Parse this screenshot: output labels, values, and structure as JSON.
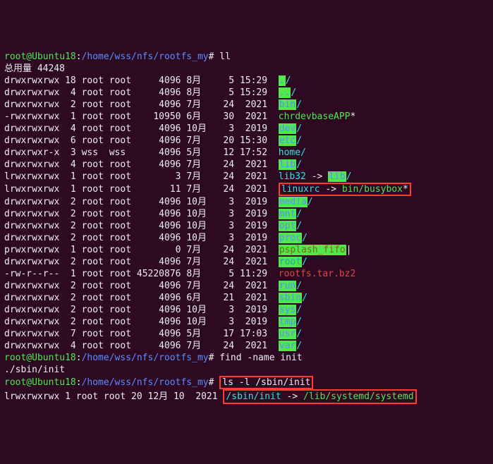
{
  "prompt1": {
    "user": "root@Ubuntu18",
    "sep1": ":",
    "path": "/home/wss/nfs/rootfs_my",
    "sep2": "#",
    "cmd": " ll"
  },
  "total": "总用量 44248",
  "rows": [
    {
      "perm": "drwxrwxrwx",
      "n": "18",
      "o": "root",
      "g": "root",
      "sz": "4096",
      "mo": "8月",
      "d": "5",
      "tm": "15:29",
      "name": ".",
      "slash": "/",
      "cls": "bg-green-block"
    },
    {
      "perm": "drwxrwxrwx",
      "n": "4",
      "o": "root",
      "g": "root",
      "sz": "4096",
      "mo": "8月",
      "d": "5",
      "tm": "15:29",
      "name": "..",
      "slash": "/",
      "cls": "bg-green-block"
    },
    {
      "perm": "drwxrwxrwx",
      "n": "2",
      "o": "root",
      "g": "root",
      "sz": "4096",
      "mo": "7月",
      "d": "24",
      "tm": "2021",
      "name": "bin",
      "slash": "/",
      "cls": "bg-green-block"
    },
    {
      "perm": "-rwxrwxrwx",
      "n": "1",
      "o": "root",
      "g": "root",
      "sz": "10950",
      "mo": "6月",
      "d": "30",
      "tm": "2021",
      "name": "chrdevbaseAPP",
      "suffix": "*",
      "cls": "green"
    },
    {
      "perm": "drwxrwxrwx",
      "n": "4",
      "o": "root",
      "g": "root",
      "sz": "4096",
      "mo": "10月",
      "d": "3",
      "tm": "2019",
      "name": "dev",
      "slash": "/",
      "cls": "bg-green-block"
    },
    {
      "perm": "drwxrwxrwx",
      "n": "6",
      "o": "root",
      "g": "root",
      "sz": "4096",
      "mo": "7月",
      "d": "20",
      "tm": "15:30",
      "name": "etc",
      "slash": "/",
      "cls": "bg-green-block"
    },
    {
      "perm": "drwxrwxr-x",
      "n": "3",
      "o": "wss",
      "g": "wss",
      "sz": "4096",
      "mo": "5月",
      "d": "12",
      "tm": "17:52",
      "name": "home",
      "slash": "/",
      "cls": "cyan"
    },
    {
      "perm": "drwxrwxrwx",
      "n": "4",
      "o": "root",
      "g": "root",
      "sz": "4096",
      "mo": "7月",
      "d": "24",
      "tm": "2021",
      "name": "lib",
      "slash": "/",
      "cls": "bg-green-block"
    },
    {
      "perm": "lrwxrwxrwx",
      "n": "1",
      "o": "root",
      "g": "root",
      "sz": "3",
      "mo": "7月",
      "d": "24",
      "tm": "2021",
      "name": "lib32",
      "arrow": " -> ",
      "target": "lib",
      "slash": "/",
      "cls": "cyan",
      "tcls": "bg-green-block"
    },
    {
      "perm": "lrwxrwxrwx",
      "n": "1",
      "o": "root",
      "g": "root",
      "sz": "11",
      "mo": "7月",
      "d": "24",
      "tm": "2021",
      "name": "linuxrc",
      "arrow": " -> ",
      "target": "bin/busybox",
      "suffix": "*",
      "cls": "cyan",
      "tcls": "green",
      "boxed": true
    },
    {
      "perm": "drwxrwxrwx",
      "n": "2",
      "o": "root",
      "g": "root",
      "sz": "4096",
      "mo": "10月",
      "d": "3",
      "tm": "2019",
      "name": "media",
      "slash": "/",
      "cls": "bg-green-block"
    },
    {
      "perm": "drwxrwxrwx",
      "n": "2",
      "o": "root",
      "g": "root",
      "sz": "4096",
      "mo": "10月",
      "d": "3",
      "tm": "2019",
      "name": "mnt",
      "slash": "/",
      "cls": "bg-green-block"
    },
    {
      "perm": "drwxrwxrwx",
      "n": "2",
      "o": "root",
      "g": "root",
      "sz": "4096",
      "mo": "10月",
      "d": "3",
      "tm": "2019",
      "name": "opt",
      "slash": "/",
      "cls": "bg-green-block"
    },
    {
      "perm": "drwxrwxrwx",
      "n": "2",
      "o": "root",
      "g": "root",
      "sz": "4096",
      "mo": "10月",
      "d": "3",
      "tm": "2019",
      "name": "proc",
      "slash": "/",
      "cls": "bg-green-block"
    },
    {
      "perm": "prwxrwxrwx",
      "n": "1",
      "o": "root",
      "g": "root",
      "sz": "0",
      "mo": "7月",
      "d": "24",
      "tm": "2021",
      "name": "psplash_fifo",
      "suffix": "|",
      "cls": "bg-green-yellow"
    },
    {
      "perm": "drwxrwxrwx",
      "n": "2",
      "o": "root",
      "g": "root",
      "sz": "4096",
      "mo": "7月",
      "d": "24",
      "tm": "2021",
      "name": "root",
      "slash": "/",
      "cls": "bg-green-cyan"
    },
    {
      "perm": "-rw-r--r--",
      "n": "1",
      "o": "root",
      "g": "root",
      "sz": "45220876",
      "mo": "8月",
      "d": "5",
      "tm": "11:29",
      "name": "rootfs.tar.bz2",
      "cls": "red"
    },
    {
      "perm": "drwxrwxrwx",
      "n": "2",
      "o": "root",
      "g": "root",
      "sz": "4096",
      "mo": "7月",
      "d": "24",
      "tm": "2021",
      "name": "run",
      "slash": "/",
      "cls": "bg-green-block"
    },
    {
      "perm": "drwxrwxrwx",
      "n": "2",
      "o": "root",
      "g": "root",
      "sz": "4096",
      "mo": "6月",
      "d": "21",
      "tm": "2021",
      "name": "sbin",
      "slash": "/",
      "cls": "bg-green-block"
    },
    {
      "perm": "drwxrwxrwx",
      "n": "2",
      "o": "root",
      "g": "root",
      "sz": "4096",
      "mo": "10月",
      "d": "3",
      "tm": "2019",
      "name": "sys",
      "slash": "/",
      "cls": "bg-green-block"
    },
    {
      "perm": "drwxrwxrwx",
      "n": "2",
      "o": "root",
      "g": "root",
      "sz": "4096",
      "mo": "10月",
      "d": "3",
      "tm": "2019",
      "name": "tmp",
      "slash": "/",
      "cls": "bg-green-block"
    },
    {
      "perm": "drwxrwxrwx",
      "n": "7",
      "o": "root",
      "g": "root",
      "sz": "4096",
      "mo": "5月",
      "d": "17",
      "tm": "17:03",
      "name": "usr",
      "slash": "/",
      "cls": "bg-green-block"
    },
    {
      "perm": "drwxrwxrwx",
      "n": "4",
      "o": "root",
      "g": "root",
      "sz": "4096",
      "mo": "7月",
      "d": "24",
      "tm": "2021",
      "name": "var",
      "slash": "/",
      "cls": "bg-green-block"
    }
  ],
  "prompt2": {
    "user": "root@Ubuntu18",
    "sep1": ":",
    "path": "/home/wss/nfs/rootfs_my",
    "sep2": "#",
    "cmd": " find -name init"
  },
  "findout": "./sbin/init",
  "prompt3": {
    "user": "root@Ubuntu18",
    "sep1": ":",
    "path": "/home/wss/nfs/rootfs_my",
    "sep2": "#",
    "cmd": "ls -l /sbin/init"
  },
  "lastrow": {
    "pre": "lrwxrwxrwx 1 root root 20 12月 10  2021 ",
    "name": "/sbin/init",
    "arrow": " -> ",
    "target": "/lib/systemd/systemd"
  }
}
